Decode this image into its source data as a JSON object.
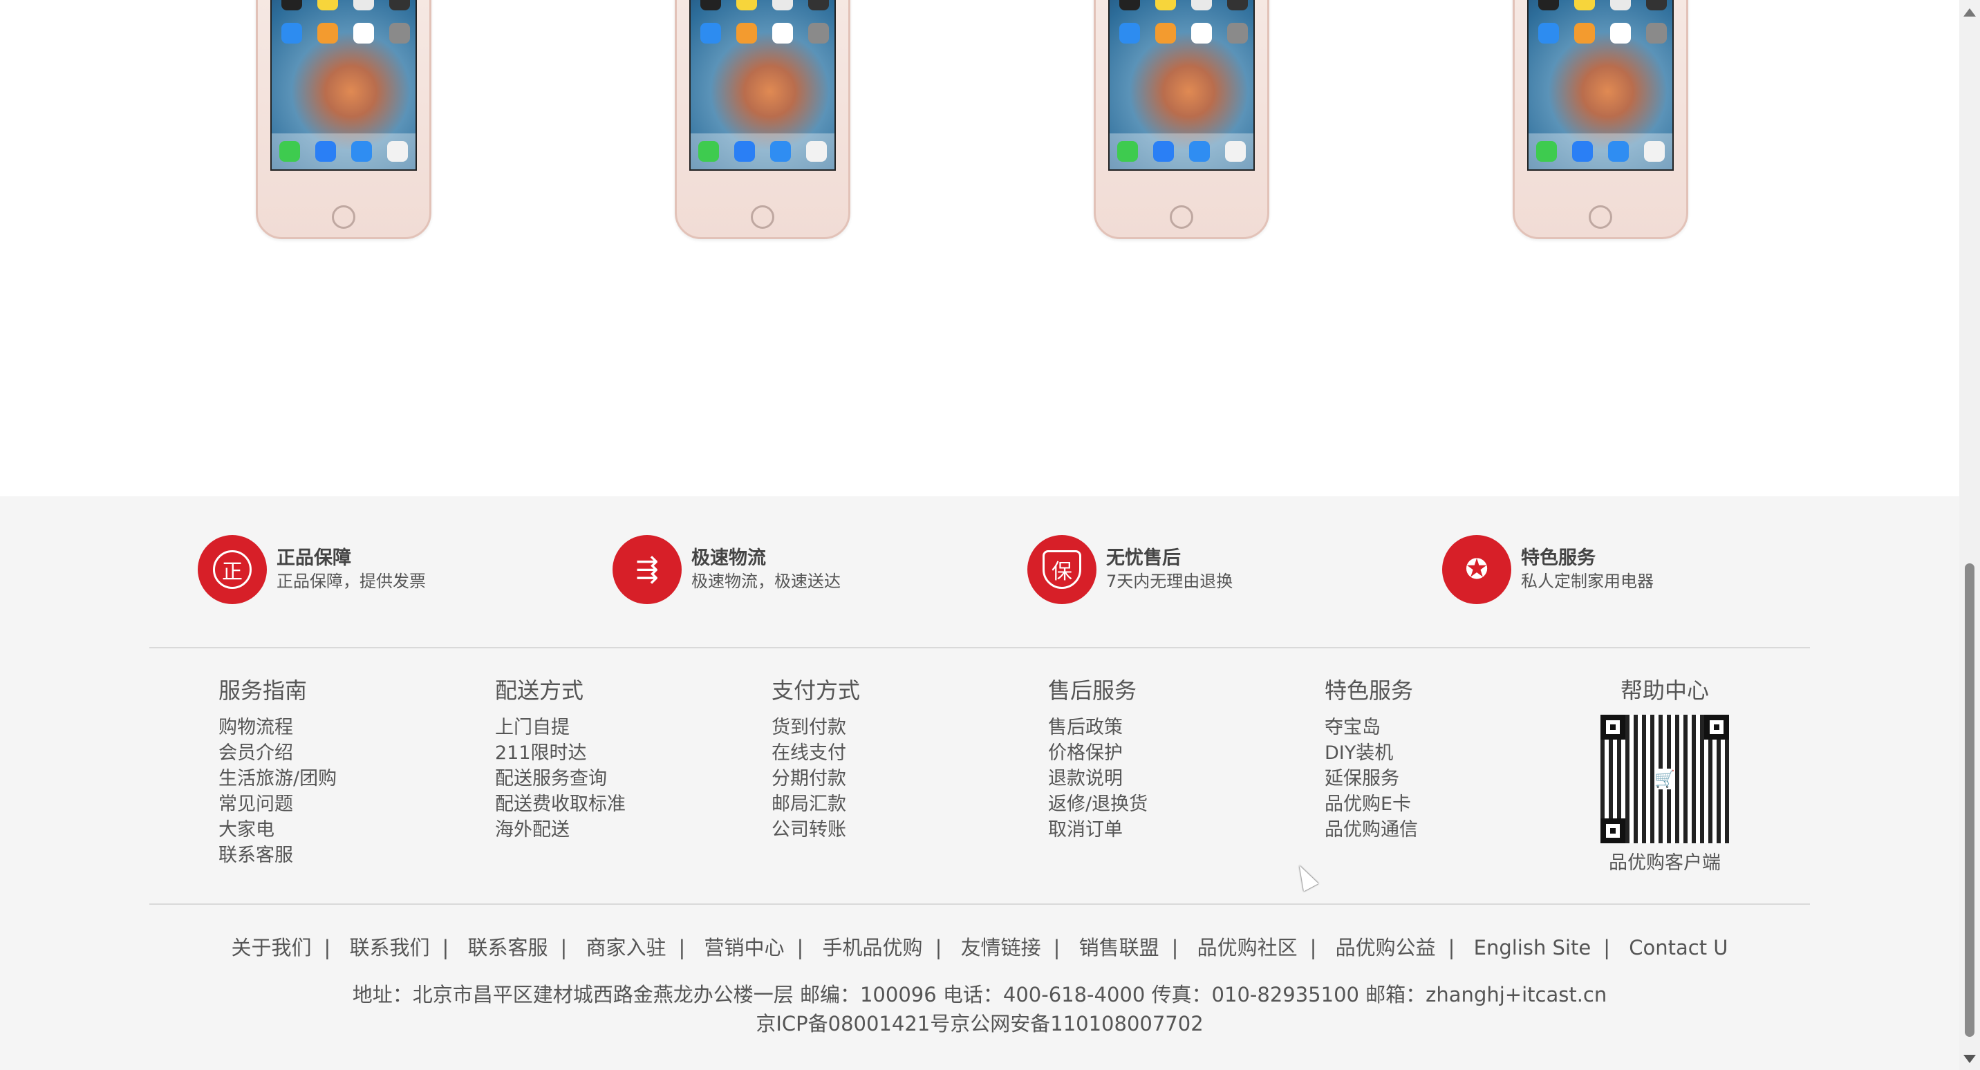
{
  "products": {
    "count": 4
  },
  "services": [
    {
      "icon": "authentic-icon",
      "glyph": "正",
      "title": "正品保障",
      "subtitle": "正品保障，提供发票"
    },
    {
      "icon": "delivery-truck-icon",
      "glyph": "⇶",
      "title": "极速物流",
      "subtitle": "极速物流，极速送达"
    },
    {
      "icon": "shield-icon",
      "glyph": "保",
      "title": "无忧售后",
      "subtitle": "7天内无理由退换"
    },
    {
      "icon": "award-icon",
      "glyph": "✪",
      "title": "特色服务",
      "subtitle": "私人定制家用电器"
    }
  ],
  "columns": [
    {
      "title": "服务指南",
      "items": [
        "购物流程",
        "会员介绍",
        "生活旅游/团购",
        "常见问题",
        "大家电",
        "联系客服"
      ]
    },
    {
      "title": "配送方式",
      "items": [
        "上门自提",
        "211限时达",
        "配送服务查询",
        "配送费收取标准",
        "海外配送"
      ]
    },
    {
      "title": "支付方式",
      "items": [
        "货到付款",
        "在线支付",
        "分期付款",
        "邮局汇款",
        "公司转账"
      ]
    },
    {
      "title": "售后服务",
      "items": [
        "售后政策",
        "价格保护",
        "退款说明",
        "返修/退换货",
        "取消订单"
      ]
    },
    {
      "title": "特色服务",
      "items": [
        "夺宝岛",
        "DIY装机",
        "延保服务",
        "品优购E卡",
        "品优购通信"
      ]
    }
  ],
  "help": {
    "title": "帮助中心",
    "caption": "品优购客户端"
  },
  "links": [
    "关于我们",
    "联系我们",
    "联系客服",
    "商家入驻",
    "营销中心",
    "手机品优购",
    "友情链接",
    "销售联盟",
    "品优购社区",
    "品优购公益",
    "English Site",
    "Contact U"
  ],
  "address": "地址：北京市昌平区建材城西路金燕龙办公楼一层 邮编：100096 电话：400-618-4000 传真：010-82935100 邮箱：zhanghj+itcast.cn",
  "icp": "京ICP备08001421号京公网安备110108007702",
  "colors": {
    "accent": "#d71f28",
    "footer_bg": "#f5f5f5",
    "text": "#555555"
  }
}
